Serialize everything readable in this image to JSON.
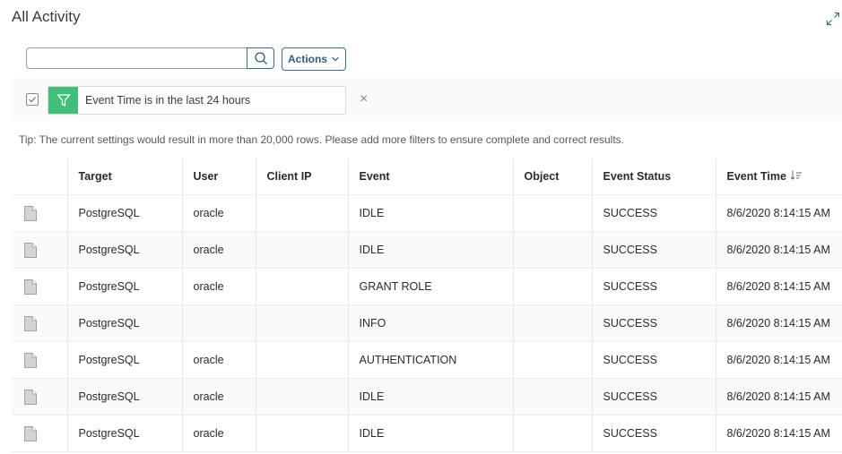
{
  "header": {
    "title": "All Activity",
    "expand_icon": "expand-icon"
  },
  "search": {
    "value": "",
    "placeholder": "",
    "icon": "search-icon"
  },
  "actions": {
    "label": "Actions",
    "icon": "chevron-down-icon"
  },
  "filter": {
    "checked": true,
    "icon": "filter-icon",
    "text": "Event Time is in the last 24 hours",
    "remove_icon": "close-icon",
    "remove_label": "×",
    "accent": "#3fbf78"
  },
  "tip": "Tip: The current settings would result in more than 20,000 rows. Please add more filters to ensure complete and correct results.",
  "table": {
    "columns": [
      "",
      "Target",
      "User",
      "Client IP",
      "Event",
      "Object",
      "Event Status",
      "Event Time"
    ],
    "sort": {
      "column": "Event Time",
      "direction": "descending"
    },
    "rows": [
      {
        "target": "PostgreSQL",
        "user": "oracle",
        "client_ip": "",
        "event": "IDLE",
        "object": "",
        "status": "SUCCESS",
        "time": "8/6/2020 8:14:15 AM"
      },
      {
        "target": "PostgreSQL",
        "user": "oracle",
        "client_ip": "",
        "event": "IDLE",
        "object": "",
        "status": "SUCCESS",
        "time": "8/6/2020 8:14:15 AM"
      },
      {
        "target": "PostgreSQL",
        "user": "oracle",
        "client_ip": "",
        "event": "GRANT ROLE",
        "object": "",
        "status": "SUCCESS",
        "time": "8/6/2020 8:14:15 AM"
      },
      {
        "target": "PostgreSQL",
        "user": "",
        "client_ip": "",
        "event": "INFO",
        "object": "",
        "status": "SUCCESS",
        "time": "8/6/2020 8:14:15 AM"
      },
      {
        "target": "PostgreSQL",
        "user": "oracle",
        "client_ip": "",
        "event": "AUTHENTICATION",
        "object": "",
        "status": "SUCCESS",
        "time": "8/6/2020 8:14:15 AM"
      },
      {
        "target": "PostgreSQL",
        "user": "oracle",
        "client_ip": "",
        "event": "IDLE",
        "object": "",
        "status": "SUCCESS",
        "time": "8/6/2020 8:14:15 AM"
      },
      {
        "target": "PostgreSQL",
        "user": "oracle",
        "client_ip": "",
        "event": "IDLE",
        "object": "",
        "status": "SUCCESS",
        "time": "8/6/2020 8:14:15 AM"
      }
    ]
  }
}
